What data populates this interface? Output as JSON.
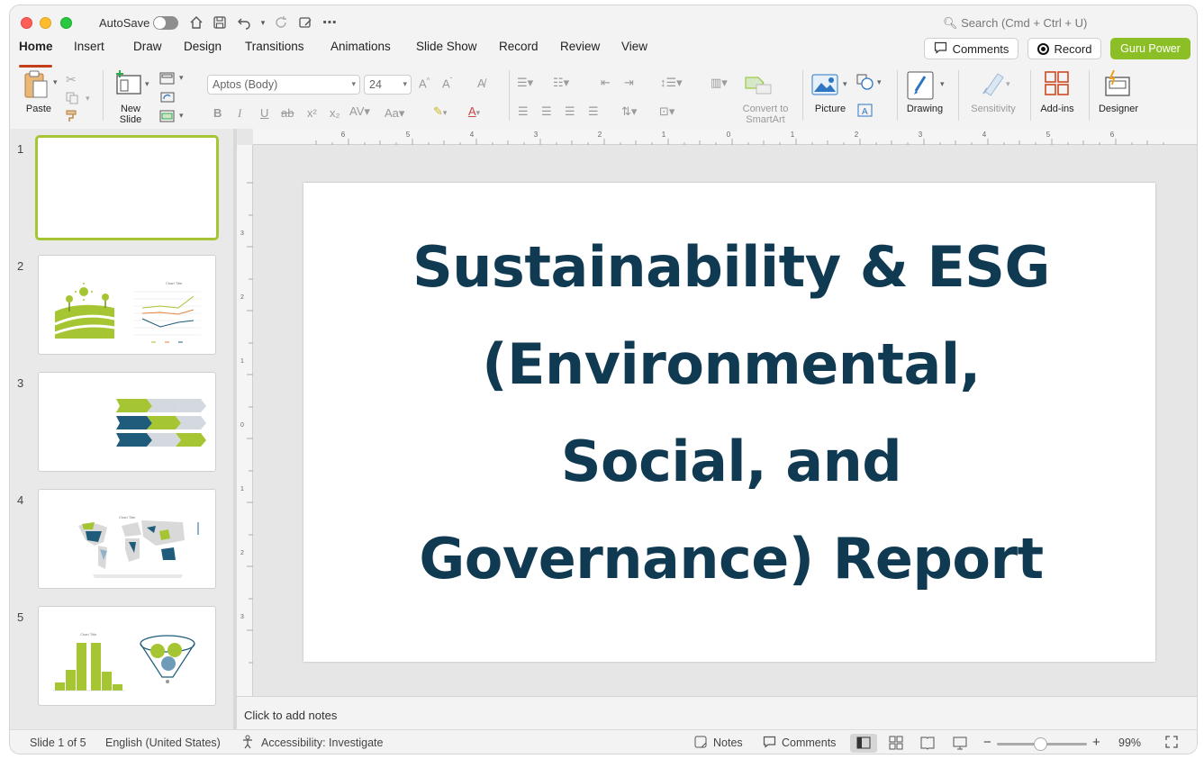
{
  "titlebar": {
    "autosave_label": "AutoSave",
    "search_placeholder": "Search (Cmd + Ctrl + U)"
  },
  "tabs": [
    "Home",
    "Insert",
    "Draw",
    "Design",
    "Transitions",
    "Animations",
    "Slide Show",
    "Record",
    "Review",
    "View"
  ],
  "header_buttons": {
    "comments": "Comments",
    "record": "Record",
    "guru": "Guru Power"
  },
  "ribbon": {
    "paste": "Paste",
    "new_slide": "New Slide",
    "font_name": "Aptos (Body)",
    "font_size": "24",
    "convert_smartart": "Convert to SmartArt",
    "picture": "Picture",
    "drawing": "Drawing",
    "sensitivity": "Sensitivity",
    "addins": "Add-ins",
    "designer": "Designer"
  },
  "slides": {
    "numbers": [
      "1",
      "2",
      "3",
      "4",
      "5"
    ],
    "thumb2_chart_title": "Chart Title",
    "thumb4_chart_title": "Chart Title",
    "thumb5_chart_title": "Chart Title"
  },
  "current_slide": {
    "title": "Sustainability & ESG (Environmental, Social, and Governance) Report"
  },
  "notes_placeholder": "Click to add notes",
  "status": {
    "slide_indicator": "Slide 1 of 5",
    "language": "English (United States)",
    "accessibility": "Accessibility: Investigate",
    "notes": "Notes",
    "comments": "Comments",
    "zoom": "99%"
  },
  "colors": {
    "accent_tab": "#c43e1c",
    "guru_button": "#8cbf26",
    "slide_title": "#0f3a52",
    "selected_thumb": "#a5c532"
  }
}
